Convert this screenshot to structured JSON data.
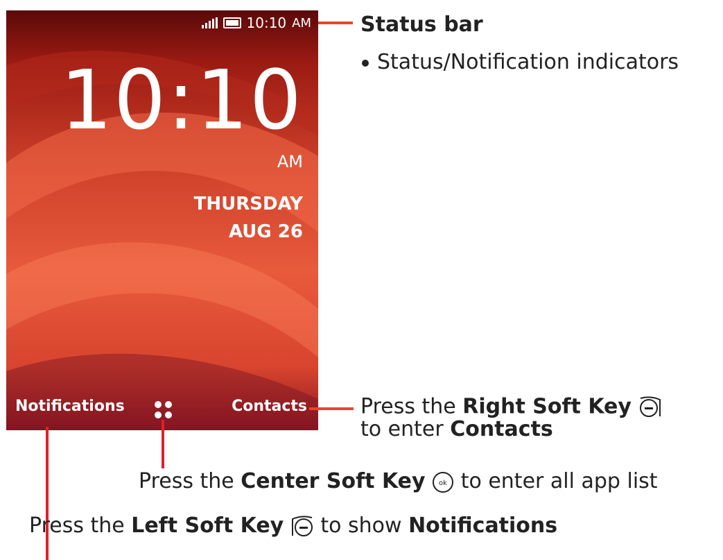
{
  "status_bar": {
    "time": "10:10",
    "ampm": "AM"
  },
  "lockscreen": {
    "clock": "10:10",
    "ampm": "AM",
    "weekday": "THURSDAY",
    "date": "AUG 26",
    "left_soft": "Notifications",
    "right_soft": "Contacts"
  },
  "annotations": {
    "status_title": "Status bar",
    "status_bullet": "Status/Notification indicators",
    "right": {
      "pre": "Press the ",
      "key": "Right Soft Key",
      "line2_pre": "to enter ",
      "line2_bold": "Contacts"
    },
    "center": {
      "pre": "Press the ",
      "key": "Center Soft Key",
      "post": "to enter all app list"
    },
    "left": {
      "pre": "Press the ",
      "key": "Left Soft Key",
      "mid": "to show ",
      "bold": "Notifications"
    }
  },
  "icons": [
    "signal-icon",
    "battery-icon",
    "app-menu-dots-icon",
    "right-soft-key-icon",
    "center-ok-key-icon",
    "left-soft-key-icon"
  ],
  "colors": {
    "connector_orange": "#e8452c",
    "connector_red": "#e0202a"
  }
}
